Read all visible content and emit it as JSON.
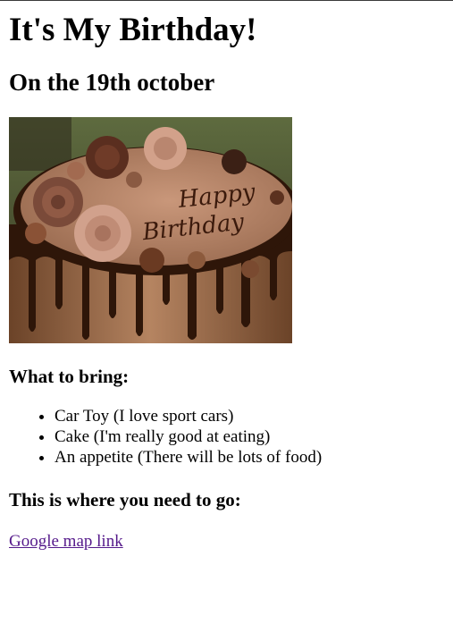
{
  "page": {
    "title": "It's My Birthday!",
    "date": "On the 19th october",
    "bring_heading": "What to bring:",
    "bring_items": [
      "Car Toy (I love sport cars)",
      "Cake (I'm really good at eating)",
      "An appetite (There will be lots of food)"
    ],
    "location_heading": "This is where you need to go:",
    "map_link": "Google map link"
  },
  "image": {
    "subject": "chocolate-birthday-cake-photo",
    "cake_text": "Happy Birthday"
  },
  "colors": {
    "link": "#551a8b",
    "text": "#000000",
    "background": "#ffffff"
  }
}
